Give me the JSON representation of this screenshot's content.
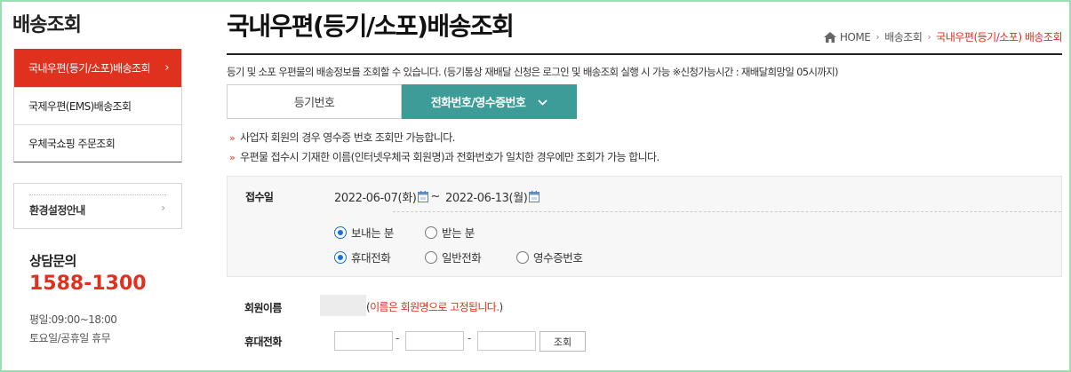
{
  "sidebar": {
    "title": "배송조회",
    "items": [
      {
        "label": "국내우편(등기/소포)배송조회",
        "chevron": "›"
      },
      {
        "label": "국제우편(EMS)배송조회"
      },
      {
        "label": "우체국쇼핑 주문조회"
      }
    ],
    "env_label": "환경설정안내",
    "env_chevron": "›",
    "cs_title": "상담문의",
    "cs_phone": "1588-1300",
    "cs_hours": "평일:09:00~18:00",
    "cs_holiday": "토요일/공휴일 휴무"
  },
  "header": {
    "title": "국내우편(등기/소포)배송조회",
    "breadcrumb": {
      "home": "HOME",
      "level1": "배송조회",
      "current": "국내우편(등기/소포) 배송조회",
      "separator": "›"
    }
  },
  "intro": "등기 및 소포 우편물의 배송정보를 조회할 수 있습니다. (등기통상 재배달 신청은 로그인 및 배송조회 실행 시 가능 ※신청가능시간 : 재배달희망일 05시까지)",
  "tabs": [
    {
      "label": "등기번호",
      "active": false
    },
    {
      "label": "전화번호/영수증번호",
      "active": true,
      "chevron": "⌄"
    }
  ],
  "notes": [
    "사업자 회원의 경우 영수증 번호 조회만 가능합니다.",
    "우편물 접수시 기재한 이름(인터넷우체국 회원명)과 전화번호가 일치한 경우에만 조회가 가능 합니다."
  ],
  "note_bullet": "»",
  "search": {
    "date_label": "접수일",
    "start_date": "2022-06-07(화)",
    "date_separator": "~",
    "end_date": "2022-06-13(월)",
    "sender_options": [
      {
        "label": "보내는 분",
        "checked": true
      },
      {
        "label": "받는 분",
        "checked": false
      }
    ],
    "phone_type_options": [
      {
        "label": "휴대전화",
        "checked": true
      },
      {
        "label": "일반전화",
        "checked": false
      },
      {
        "label": "영수증번호",
        "checked": false
      }
    ]
  },
  "form": {
    "member_name_label": "회원이름",
    "name_note_open": "(",
    "name_note_red": "이름은 회원명으로 고정됩니다.",
    "name_note_close": ")",
    "mobile_label": "휴대전화",
    "phone_dash": "-",
    "search_button": "조회"
  },
  "colors": {
    "accent_red": "#e0301e",
    "tab_teal": "#3e9c98",
    "radio_blue": "#1a6fd6",
    "frame_green": "#9adfb1"
  },
  "icons": [
    "home-icon",
    "calendar-icon",
    "chevron-right-icon",
    "chevron-down-icon"
  ]
}
